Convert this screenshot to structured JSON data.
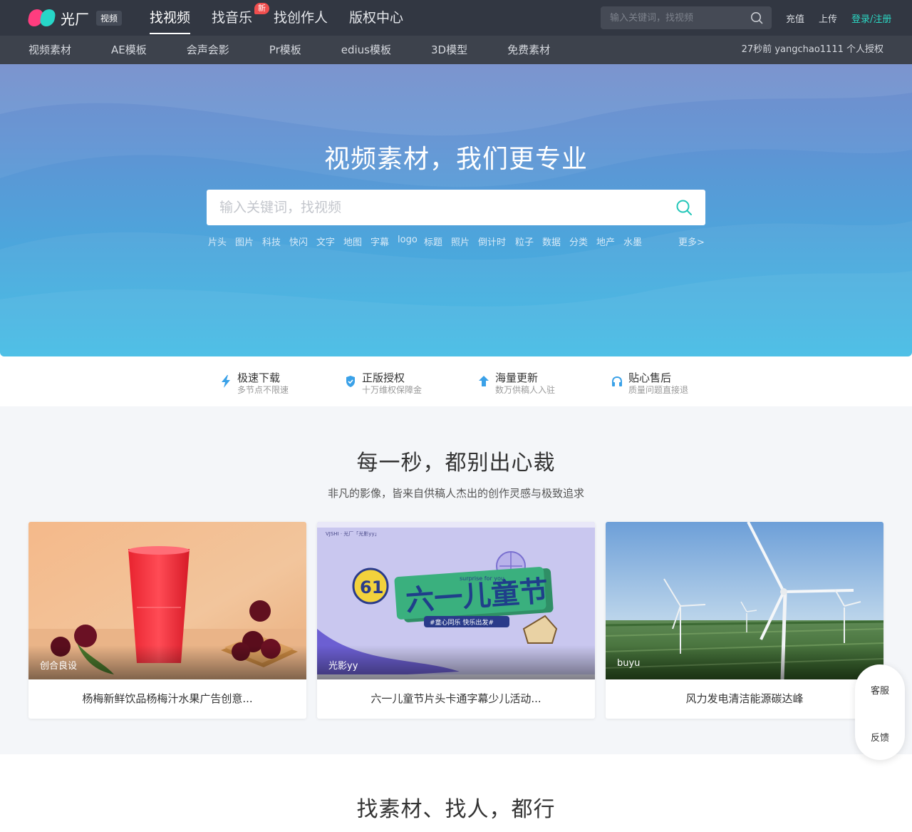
{
  "brand": {
    "name": "光厂",
    "tag": "视频"
  },
  "main_nav": [
    {
      "label": "找视频",
      "active": true
    },
    {
      "label": "找音乐",
      "badge": "新"
    },
    {
      "label": "找创作人"
    },
    {
      "label": "版权中心"
    }
  ],
  "top_search": {
    "placeholder": "输入关键词，找视频"
  },
  "top_links": {
    "recharge": "充值",
    "upload": "上传",
    "login": "登录/注册"
  },
  "sub_nav": [
    "视频素材",
    "AE模板",
    "会声会影",
    "Pr模板",
    "edius模板",
    "3D模型",
    "免费素材"
  ],
  "sub_notice": "27秒前 yangchao1111 个人授权",
  "hero": {
    "title": "视频素材，我们更专业",
    "search_placeholder": "输入关键词，找视频",
    "hot_tags": [
      "片头",
      "图片",
      "科技",
      "快闪",
      "文字",
      "地图",
      "字幕",
      "logo",
      "标题",
      "照片",
      "倒计时",
      "粒子",
      "数据",
      "分类",
      "地产",
      "水墨"
    ],
    "more": "更多>"
  },
  "features": [
    {
      "icon": "lightning-icon",
      "title": "极速下载",
      "sub": "多节点不限速"
    },
    {
      "icon": "shield-check-icon",
      "title": "正版授权",
      "sub": "十万维权保障金"
    },
    {
      "icon": "arrow-up-icon",
      "title": "海量更新",
      "sub": "数万供稿人入驻"
    },
    {
      "icon": "headset-icon",
      "title": "贴心售后",
      "sub": "质量问题直接退"
    }
  ],
  "showcase": {
    "title": "每一秒，都别出心裁",
    "subtitle": "非凡的影像，皆来自供稿人杰出的创作灵感与极致追求",
    "cards": [
      {
        "author": "创合良设",
        "title": "杨梅新鲜饮品杨梅汁水果广告创意..."
      },
      {
        "author": "光影yy",
        "title": "六一儿童节片头卡通字幕少儿活动..."
      },
      {
        "author": "buyu",
        "title": "风力发电清洁能源碳达峰"
      }
    ],
    "thumb2_texts": {
      "number": "61",
      "headline": "六一儿童节",
      "slogan": "#童心同乐 快乐出发#",
      "caption": "surprise for you",
      "watermark": "VJSHI · 光厂「光影yy」"
    }
  },
  "side_float": {
    "service": "客服",
    "feedback": "反馈"
  },
  "bottom_title": "找素材、找人，都行",
  "colors": {
    "topbar": "#323742",
    "subnav": "#3d424c",
    "accent": "#2bd8c4",
    "badge": "#f04e4e",
    "hero_top": "#6b87c9",
    "hero_bottom": "#3dbae4"
  }
}
